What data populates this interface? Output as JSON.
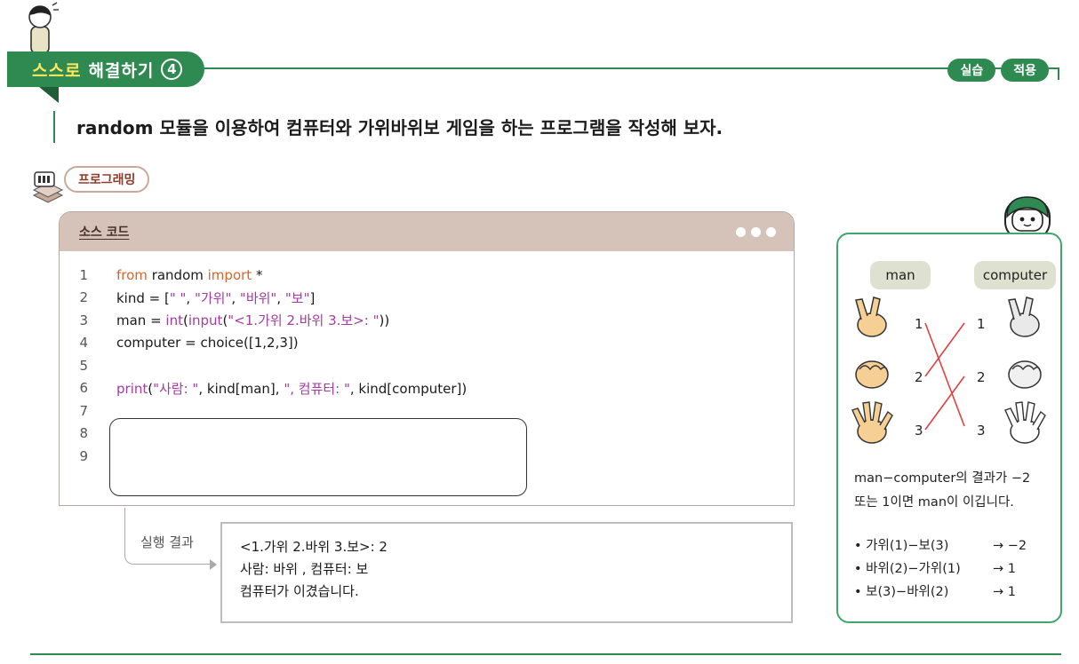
{
  "header": {
    "title_highlight": "스스로",
    "title_rest": "해결하기",
    "title_number": "4",
    "badges": [
      "실습",
      "적용"
    ]
  },
  "instruction": "random 모듈을 이용하여 컴퓨터와 가위바위보 게임을 하는 프로그램을 작성해 보자.",
  "programming_label": "프로그래밍",
  "code_window": {
    "title": "소스 코드",
    "line_numbers": [
      "1",
      "2",
      "3",
      "4",
      "5",
      "6",
      "7",
      "8",
      "9"
    ]
  },
  "result": {
    "label": "실행 결과",
    "lines": [
      "<1.가위 2.바위 3.보>: 2",
      "사람: 바위 , 컴퓨터: 보",
      "컴퓨터가 이겼습니다."
    ]
  },
  "side_panel": {
    "man_label": "man",
    "computer_label": "computer",
    "left_numbers": [
      "1",
      "2",
      "3"
    ],
    "right_numbers": [
      "1",
      "2",
      "3"
    ],
    "rule_text_1": "man−computer의 결과가 −2",
    "rule_text_2": "또는 1이면 man이 이깁니다.",
    "bullets": [
      {
        "left": "• 가위(1)−보(3)",
        "right": "→ −2"
      },
      {
        "left": "• 바위(2)−가위(1)",
        "right": "→ 1"
      },
      {
        "left": "• 보(3)−바위(2)",
        "right": "→ 1"
      }
    ]
  },
  "colors": {
    "accent": "#2f8a52",
    "title_highlight": "#ffe65a",
    "code_header": "#d5c2b8",
    "keyword": "#d9642a",
    "string_fn": "#a43ca0",
    "cross_line": "#e04040"
  }
}
